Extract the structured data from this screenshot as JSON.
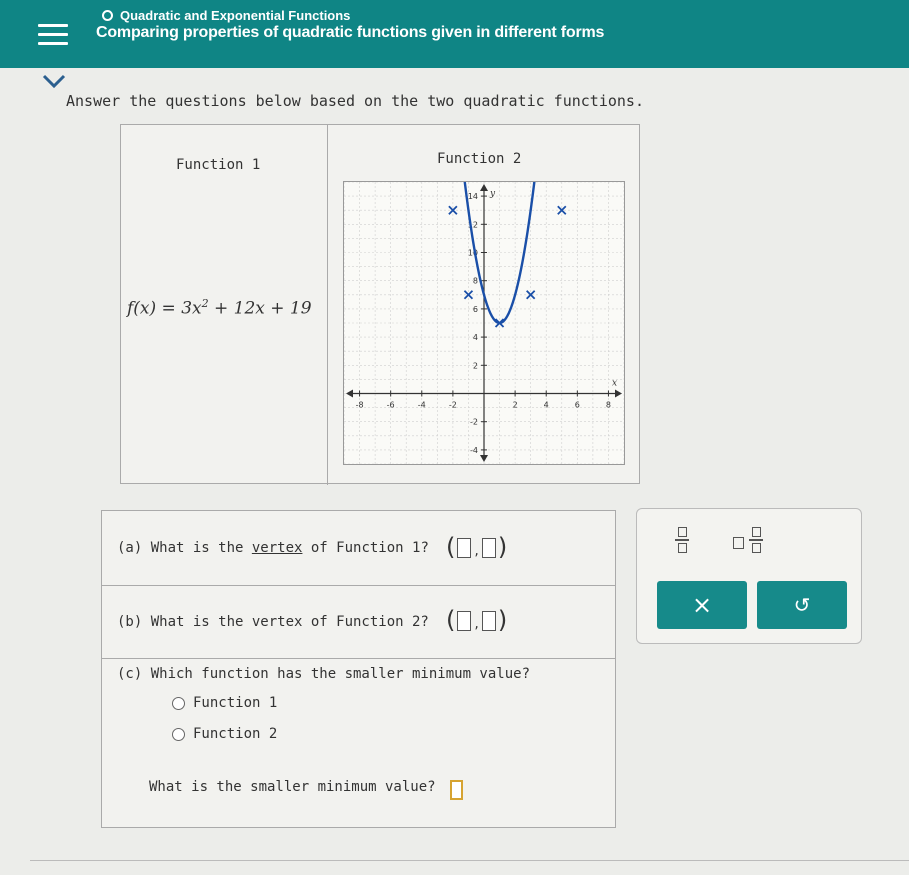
{
  "header": {
    "course": "Quadratic and Exponential Functions",
    "title": "Comparing properties of quadratic functions given in different forms"
  },
  "instructions": "Answer the questions below based on the two quadratic functions.",
  "functions": {
    "f1_label": "Function 1",
    "f2_label": "Function 2",
    "f1_formula_lhs": "f(x) = 3x",
    "f1_formula_exp": "2",
    "f1_formula_rhs": " + 12x + 19"
  },
  "chart_data": {
    "type": "line",
    "xlabel": "x",
    "ylabel": "y",
    "xlim": [
      -9,
      9
    ],
    "ylim": [
      -5,
      15
    ],
    "x_ticks": [
      -8,
      -6,
      -4,
      -2,
      2,
      4,
      6,
      8
    ],
    "y_ticks": [
      -4,
      -2,
      2,
      4,
      6,
      8,
      10,
      12,
      14
    ],
    "x_tick_labels": [
      "-8",
      "-6",
      "-4",
      "-2",
      "2",
      "4",
      "6",
      "8"
    ],
    "y_tick_labels": [
      "-4",
      "-2",
      "2",
      "4",
      "6",
      "8",
      "10",
      "12",
      "14"
    ],
    "grid": true,
    "series": [
      {
        "points": [
          [
            -2.8,
            14
          ],
          [
            -1,
            7
          ],
          [
            1,
            5
          ],
          [
            3,
            7
          ],
          [
            5,
            14
          ]
        ],
        "marked_points": [
          [
            -2,
            13
          ],
          [
            -1,
            7
          ],
          [
            1,
            5
          ],
          [
            3,
            7
          ],
          [
            5,
            13
          ]
        ]
      }
    ]
  },
  "questions": {
    "a": "(a) What is the vertex of Function 1?",
    "a_underlined": "vertex",
    "b": "(b) What is the vertex of Function 2?",
    "c": "(c) Which function has the smaller minimum value?",
    "c_option1": "Function 1",
    "c_option2": "Function 2",
    "min_value": "What is the smaller minimum value?"
  },
  "tools": {
    "clear_symbol": "×",
    "undo_symbol": "↺"
  },
  "colors": {
    "header": "#0f8585",
    "button": "#168a8a",
    "curve": "#1a4fa8",
    "answer_border": "#d6a331"
  }
}
